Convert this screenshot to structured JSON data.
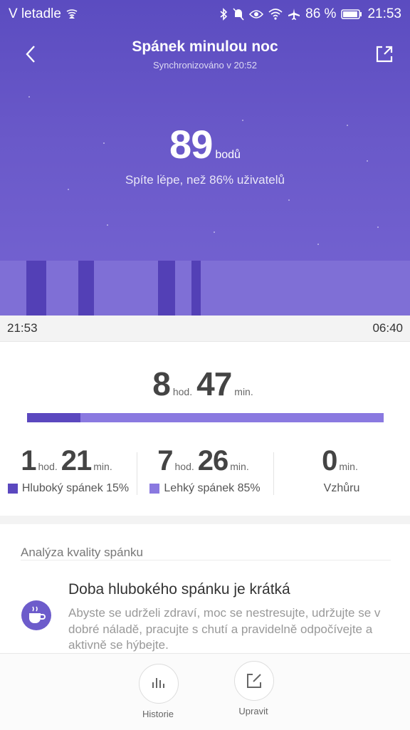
{
  "status_bar": {
    "carrier": "V letadle",
    "battery_percent": "86 %",
    "time": "21:53",
    "icons": [
      "airplay-icon",
      "bluetooth-icon",
      "mute-icon",
      "eye-icon",
      "wifi-icon",
      "airplane-icon",
      "battery-icon"
    ]
  },
  "header": {
    "title": "Spánek minulou noc",
    "subtitle": "Synchronizováno v 20:52",
    "back_icon": "chevron-left-icon",
    "share_icon": "share-icon"
  },
  "score": {
    "value": "89",
    "unit": "bodů",
    "comparison": "Spíte lépe, než 86% uživatelů"
  },
  "timeline": {
    "start": "21:53",
    "end": "06:40",
    "deep_segments": [
      {
        "from": 0.064,
        "to": 0.113
      },
      {
        "from": 0.191,
        "to": 0.229
      },
      {
        "from": 0.385,
        "to": 0.427
      },
      {
        "from": 0.467,
        "to": 0.49
      }
    ]
  },
  "total": {
    "hours": "8",
    "hours_unit": "hod.",
    "minutes": "47",
    "minutes_unit": "min.",
    "deep_fraction": 0.15
  },
  "breakdown": [
    {
      "hours": "1",
      "hours_unit": "hod.",
      "minutes": "21",
      "minutes_unit": "min.",
      "label": "Hluboký spánek 15%",
      "color": "#5b48bf"
    },
    {
      "hours": "7",
      "hours_unit": "hod.",
      "minutes": "26",
      "minutes_unit": "min.",
      "label": "Lehký spánek 85%",
      "color": "#8a79e0"
    },
    {
      "minutes": "0",
      "minutes_unit": "min.",
      "label": "Vzhůru"
    }
  ],
  "analysis": {
    "section_title": "Analýza kvality spánku",
    "tip_title": "Doba hlubokého spánku je krátká",
    "tip_body": "Abyste se udrželi zdraví, moc se nestresujte, udržujte se v dobré náladě, pracujte s chutí a pravidelně odpočívejte a aktivně se hýbejte.",
    "tip_icon": "coffee-cup-icon"
  },
  "footer": {
    "history_label": "Historie",
    "edit_label": "Upravit",
    "history_icon": "bar-chart-icon",
    "edit_icon": "edit-icon"
  },
  "colors": {
    "hero_top": "#5b4cc0",
    "hero_bottom": "#7564d2",
    "deep": "#5b48bf",
    "light": "#8a79e0"
  }
}
